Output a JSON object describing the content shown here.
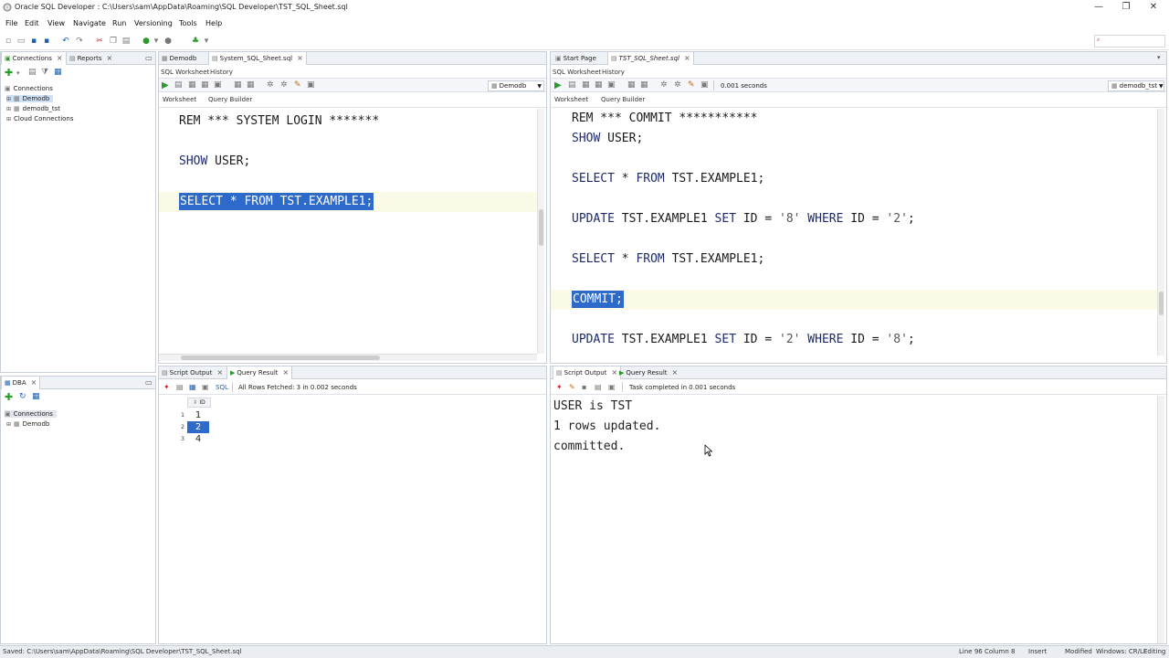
{
  "window": {
    "title": "Oracle SQL Developer : C:\\Users\\sam\\AppData\\Roaming\\SQL Developer\\TST_SQL_Sheet.sql",
    "minimize": "—",
    "restore": "❐",
    "close": "✕"
  },
  "menu": [
    "File",
    "Edit",
    "View",
    "Navigate",
    "Run",
    "Versioning",
    "Tools",
    "Help"
  ],
  "left_top": {
    "tabs": [
      "Connections",
      "Reports"
    ],
    "tree": [
      "Connections",
      "Demodb",
      "demodb_tst",
      "Cloud Connections"
    ]
  },
  "left_bottom": {
    "tab": "DBA",
    "tree": [
      "Connections",
      "Demodb"
    ]
  },
  "editor_left": {
    "tabs": [
      "Demodb",
      "System_SQL_Sheet.sql"
    ],
    "subtabs": [
      "SQL Worksheet",
      "History"
    ],
    "view_tabs": [
      "Worksheet",
      "Query Builder"
    ],
    "connection": "Demodb",
    "lines": {
      "l1": "REM *** SYSTEM LOGIN *******",
      "l2_kw": "SHOW",
      "l2_rest": " USER;",
      "l3_a": "SELECT",
      "l3_b": " * ",
      "l3_c": "FROM",
      "l3_d": " TST.EXAMPLE1;"
    }
  },
  "editor_right": {
    "tabs": [
      "Start Page",
      "TST_SQL_Sheet.sql"
    ],
    "subtabs": [
      "SQL Worksheet",
      "History"
    ],
    "view_tabs": [
      "Worksheet",
      "Query Builder"
    ],
    "timing": "0.001 seconds",
    "connection": "demodb_tst",
    "lines": {
      "l1": "REM *** COMMIT ***********",
      "l2_kw": "SHOW",
      "l2_rest": " USER;",
      "l3_a": "SELECT",
      "l3_b": " * ",
      "l3_c": "FROM",
      "l3_d": " TST.EXAMPLE1;",
      "l4_a": "UPDATE",
      "l4_b": " TST.EXAMPLE1 ",
      "l4_c": "SET",
      "l4_d": " ID = ",
      "l4_e": "'8'",
      "l4_f": " WHERE ",
      "l4_g": "ID = ",
      "l4_h": "'2'",
      "l4_i": ";",
      "l5_a": "SELECT",
      "l5_b": " * ",
      "l5_c": "FROM",
      "l5_d": " TST.EXAMPLE1;",
      "l6": "COMMIT;",
      "l7_a": "UPDATE",
      "l7_b": " TST.EXAMPLE1 ",
      "l7_c": "SET",
      "l7_d": " ID = ",
      "l7_e": "'2'",
      "l7_f": " WHERE ",
      "l7_g": "ID = ",
      "l7_h": "'8'",
      "l7_i": ";"
    }
  },
  "result_left": {
    "tabs": [
      "Script Output",
      "Query Result"
    ],
    "status": "All Rows Fetched: 3 in 0.002 seconds",
    "sql_label": "SQL",
    "column": "ID",
    "rows": [
      {
        "num": "1",
        "id": "1"
      },
      {
        "num": "2",
        "id": "2"
      },
      {
        "num": "3",
        "id": "4"
      }
    ]
  },
  "result_right": {
    "tabs": [
      "Script Output",
      "Query Result"
    ],
    "status": "Task completed in 0.001 seconds",
    "output": [
      "USER is TST",
      "1 rows updated.",
      "committed."
    ]
  },
  "statusbar": {
    "saved": "Saved: C:\\Users\\sam\\AppData\\Roaming\\SQL Developer\\TST_SQL_Sheet.sql",
    "position": "Line 96 Column 8",
    "mode": "Insert",
    "modified": "Modified",
    "encoding": "Windows: CR/LF",
    "editing": "Editing"
  },
  "colors": {
    "selection": "#2e6ac9",
    "keyword": "#1e2a6e",
    "tab_bg": "#eef1f5",
    "border": "#c8cfd8"
  }
}
